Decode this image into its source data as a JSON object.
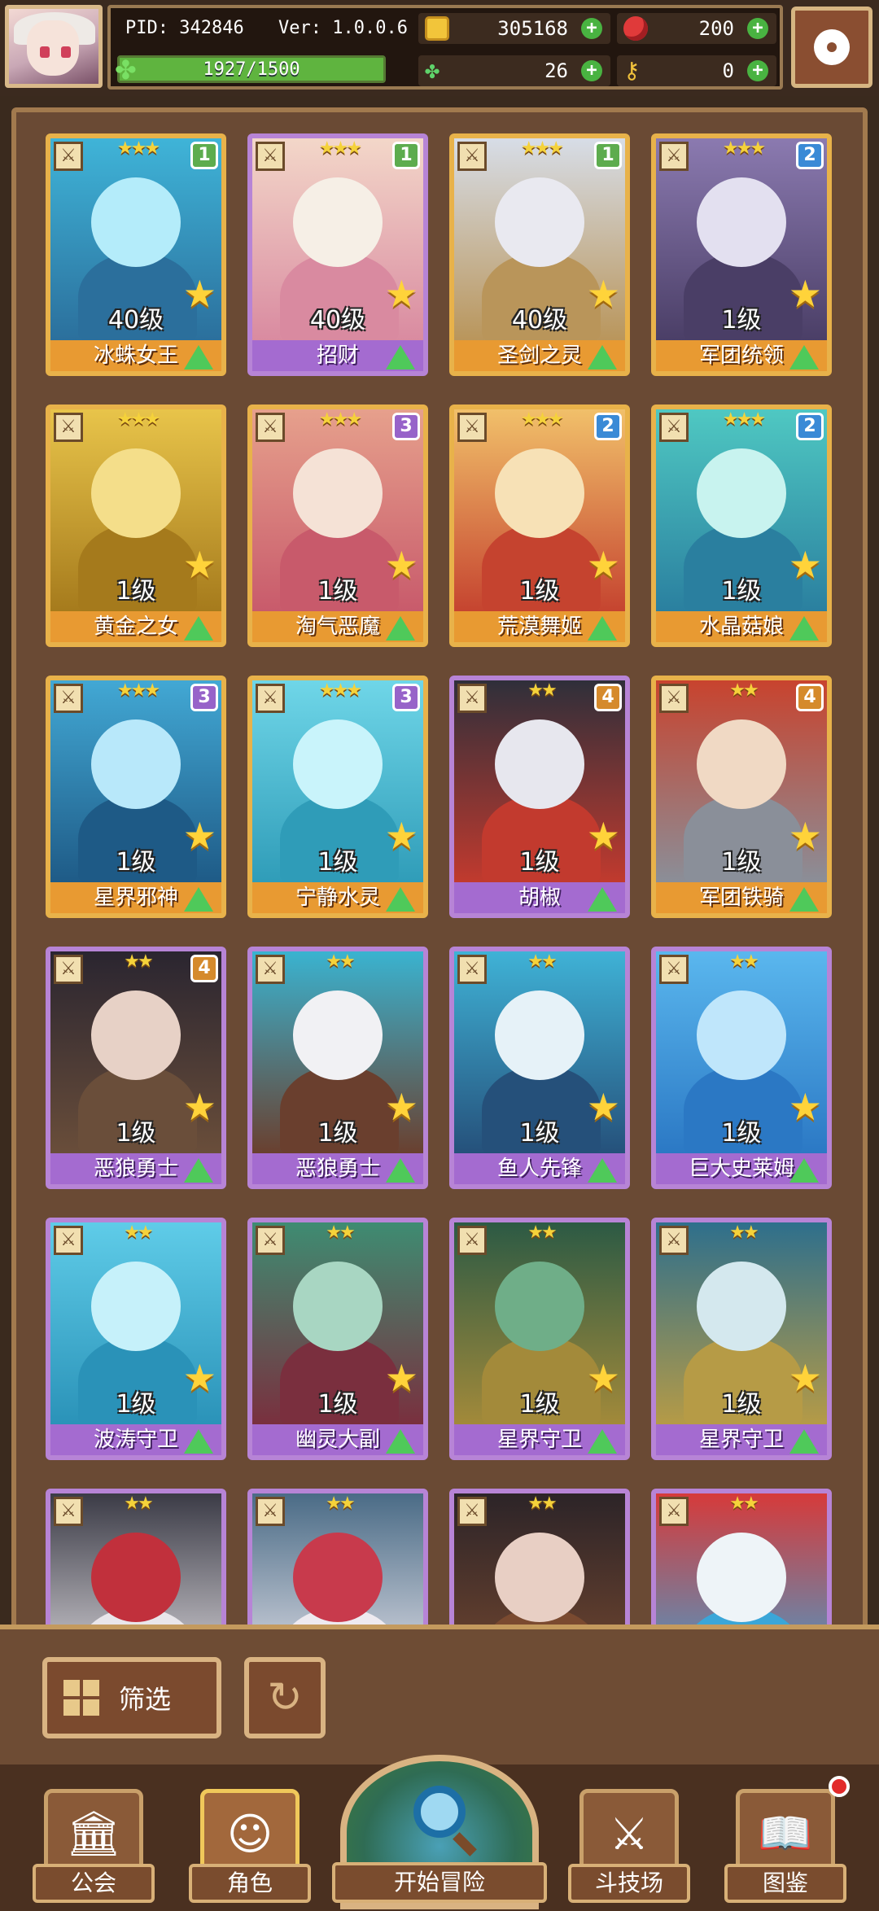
{
  "header": {
    "pid": "PID: 342846",
    "version": "Ver: 1.0.0.6",
    "coins": "305168",
    "gems": "200",
    "clover": "26",
    "keys": "0",
    "xp_text": "1927/1500",
    "xp_fraction": 1.0
  },
  "cards": [
    {
      "name": "冰蛛女王",
      "level": "40级",
      "stars": "★★★",
      "badge": "1",
      "badge_color": "green",
      "frame": "gold",
      "art": [
        "#3fb4d8",
        "#2b6f9c",
        "#b4ecfa"
      ]
    },
    {
      "name": "招财",
      "level": "40级",
      "stars": "★★★",
      "badge": "1",
      "badge_color": "green",
      "frame": "purple",
      "art": [
        "#f3d7c9",
        "#d98aa0",
        "#f6efe6"
      ]
    },
    {
      "name": "圣剑之灵",
      "level": "40级",
      "stars": "★★★",
      "badge": "1",
      "badge_color": "green",
      "frame": "gold",
      "art": [
        "#d7dde7",
        "#b9955a",
        "#e9e9f0"
      ]
    },
    {
      "name": "军团统领",
      "level": "1级",
      "stars": "★★★",
      "badge": "2",
      "badge_color": "blue",
      "frame": "gold",
      "art": [
        "#8b7ab0",
        "#4a3e66",
        "#e3e0f0"
      ]
    },
    {
      "name": "黄金之女",
      "level": "1级",
      "stars": "★★★",
      "badge": "",
      "badge_color": "",
      "frame": "gold",
      "art": [
        "#e8c44a",
        "#a57a1c",
        "#f4de8a"
      ]
    },
    {
      "name": "淘气恶魔",
      "level": "1级",
      "stars": "★★★",
      "badge": "3",
      "badge_color": "purple",
      "frame": "gold",
      "art": [
        "#e6a08c",
        "#c85a6b",
        "#f5e2d6"
      ]
    },
    {
      "name": "荒漠舞姬",
      "level": "1级",
      "stars": "★★★",
      "badge": "2",
      "badge_color": "blue",
      "frame": "gold",
      "art": [
        "#f1c06a",
        "#c5432f",
        "#f7e1b6"
      ]
    },
    {
      "name": "水晶菇娘",
      "level": "1级",
      "stars": "★★★",
      "badge": "2",
      "badge_color": "blue",
      "frame": "gold",
      "art": [
        "#4fc8c2",
        "#2a7f9f",
        "#c8f3ef"
      ]
    },
    {
      "name": "星界邪神",
      "level": "1级",
      "stars": "★★★",
      "badge": "3",
      "badge_color": "purple",
      "frame": "gold",
      "art": [
        "#42a8d4",
        "#1e5a86",
        "#b8e8fa"
      ]
    },
    {
      "name": "宁静水灵",
      "level": "1级",
      "stars": "★★★",
      "badge": "3",
      "badge_color": "purple",
      "frame": "gold",
      "art": [
        "#6fd6e8",
        "#2f9cb8",
        "#c9f4fb"
      ]
    },
    {
      "name": "胡椒",
      "level": "1级",
      "stars": "★★",
      "badge": "4",
      "badge_color": "orange",
      "frame": "purple",
      "art": [
        "#2f2f3a",
        "#c23a2e",
        "#e7e7ee"
      ]
    },
    {
      "name": "军团铁骑",
      "level": "1级",
      "stars": "★★",
      "badge": "4",
      "badge_color": "orange",
      "frame": "gold",
      "art": [
        "#c8432e",
        "#8a8f99",
        "#f0d9c4"
      ]
    },
    {
      "name": "恶狼勇士",
      "level": "1级",
      "stars": "★★",
      "badge": "4",
      "badge_color": "orange",
      "frame": "purple",
      "art": [
        "#2a2530",
        "#6a4e3a",
        "#e7d1c6"
      ]
    },
    {
      "name": "恶狼勇士",
      "level": "1级",
      "stars": "★★",
      "badge": "",
      "badge_color": "",
      "frame": "purple",
      "art": [
        "#3ab3d0",
        "#6a3f2e",
        "#f1f1f4"
      ]
    },
    {
      "name": "鱼人先锋",
      "level": "1级",
      "stars": "★★",
      "badge": "",
      "badge_color": "",
      "frame": "purple",
      "art": [
        "#3fb2d6",
        "#25507a",
        "#e6f2f8"
      ]
    },
    {
      "name": "巨大史莱姆",
      "level": "1级",
      "stars": "★★",
      "badge": "",
      "badge_color": "",
      "frame": "purple",
      "art": [
        "#5ab7ee",
        "#2b78c4",
        "#bfe6fb"
      ]
    },
    {
      "name": "波涛守卫",
      "level": "1级",
      "stars": "★★",
      "badge": "",
      "badge_color": "",
      "frame": "purple",
      "art": [
        "#5fcce8",
        "#2a92b8",
        "#c6f1fa"
      ]
    },
    {
      "name": "幽灵大副",
      "level": "1级",
      "stars": "★★",
      "badge": "",
      "badge_color": "",
      "frame": "purple",
      "art": [
        "#3e8c72",
        "#7a2f3e",
        "#a8d6c2"
      ]
    },
    {
      "name": "星界守卫",
      "level": "1级",
      "stars": "★★",
      "badge": "",
      "badge_color": "",
      "frame": "purple",
      "art": [
        "#2c5a44",
        "#a38a3a",
        "#6fae88"
      ]
    },
    {
      "name": "星界守卫",
      "level": "1级",
      "stars": "★★",
      "badge": "",
      "badge_color": "",
      "frame": "purple",
      "art": [
        "#2e6f8c",
        "#b69b46",
        "#d4e8ee"
      ]
    },
    {
      "name": "",
      "level": "",
      "stars": "★★",
      "badge": "",
      "badge_color": "",
      "frame": "purple",
      "art": [
        "#3b3b46",
        "#e9e6ea",
        "#c1303c"
      ]
    },
    {
      "name": "",
      "level": "",
      "stars": "★★",
      "badge": "",
      "badge_color": "",
      "frame": "purple",
      "art": [
        "#4a6b86",
        "#eeeaf0",
        "#c83a4c"
      ]
    },
    {
      "name": "",
      "level": "",
      "stars": "★★",
      "badge": "",
      "badge_color": "",
      "frame": "purple",
      "art": [
        "#2c2428",
        "#7a4a30",
        "#e8cfc4"
      ]
    },
    {
      "name": "",
      "level": "",
      "stars": "★★",
      "badge": "",
      "badge_color": "",
      "frame": "purple",
      "art": [
        "#d63a3a",
        "#3aa6d8",
        "#eef4f8"
      ]
    }
  ],
  "toolbar": {
    "filter_label": "筛选"
  },
  "nav": {
    "guild": "公会",
    "character": "角色",
    "adventure": "开始冒险",
    "arena": "斗技场",
    "codex": "图鉴"
  }
}
